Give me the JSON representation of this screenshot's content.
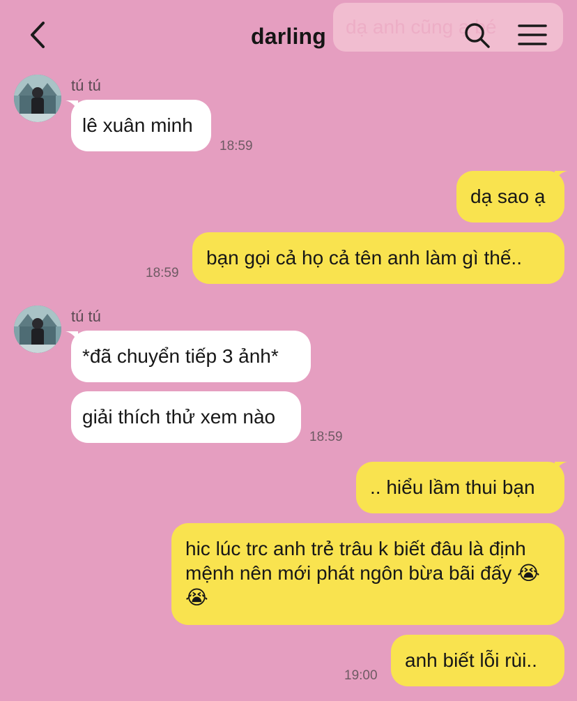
{
  "header": {
    "title": "darling",
    "ghost_preview": "dạ anh cũng ạ bé"
  },
  "colors": {
    "background": "#e59ec0",
    "incoming_bubble": "#ffffff",
    "outgoing_bubble": "#f9e34f"
  },
  "icons": {
    "back": "chevron-left-icon",
    "search": "search-icon",
    "menu": "hamburger-menu-icon"
  },
  "messages": [
    {
      "sender": "tú tú",
      "direction": "incoming",
      "text": "lê xuân minh",
      "time": "18:59"
    },
    {
      "direction": "outgoing",
      "text": "dạ sao ạ"
    },
    {
      "direction": "outgoing",
      "text": "bạn gọi cả họ cả tên anh làm gì thế..",
      "time": "18:59"
    },
    {
      "sender": "tú tú",
      "direction": "incoming",
      "text": "*đã chuyển tiếp 3 ảnh*"
    },
    {
      "direction": "incoming",
      "text": "giải thích thử xem nào",
      "time": "18:59"
    },
    {
      "direction": "outgoing",
      "text": ".. hiểu lầm thui bạn"
    },
    {
      "direction": "outgoing",
      "text": "hic lúc trc anh trẻ trâu k biết đâu là định mệnh nên mới phát ngôn bừa bãi đấy 😭😭"
    },
    {
      "direction": "outgoing",
      "text": "anh biết lỗi rùi..",
      "time": "19:00"
    }
  ]
}
